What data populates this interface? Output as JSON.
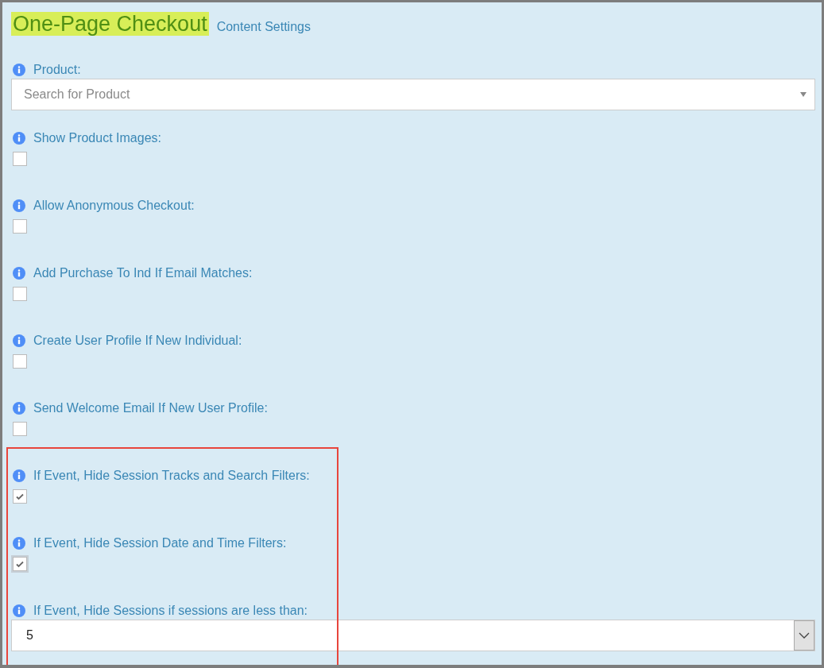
{
  "header": {
    "title": "One-Page Checkout",
    "subtitle": "Content Settings"
  },
  "groups": [
    {
      "highlighted": false,
      "fields": [
        {
          "kind": "search-select",
          "label": "Product:",
          "placeholder": "Search for Product"
        },
        {
          "kind": "checkbox",
          "label": "Show Product Images:",
          "checked": false
        },
        {
          "kind": "checkbox",
          "label": "Allow Anonymous Checkout:",
          "checked": false
        },
        {
          "kind": "checkbox",
          "label": "Add Purchase To Ind If Email Matches:",
          "checked": false
        },
        {
          "kind": "checkbox",
          "label": "Create User Profile If New Individual:",
          "checked": false
        },
        {
          "kind": "checkbox",
          "label": "Send Welcome Email If New User Profile:",
          "checked": false
        }
      ]
    },
    {
      "highlighted": true,
      "fields": [
        {
          "kind": "checkbox",
          "label": "If Event, Hide Session Tracks and Search Filters:",
          "checked": true
        },
        {
          "kind": "checkbox",
          "label": "If Event, Hide Session Date and Time Filters:",
          "checked": true
        },
        {
          "kind": "select",
          "label": "If Event, Hide Sessions if sessions are less than:",
          "value": "5"
        }
      ]
    }
  ]
}
